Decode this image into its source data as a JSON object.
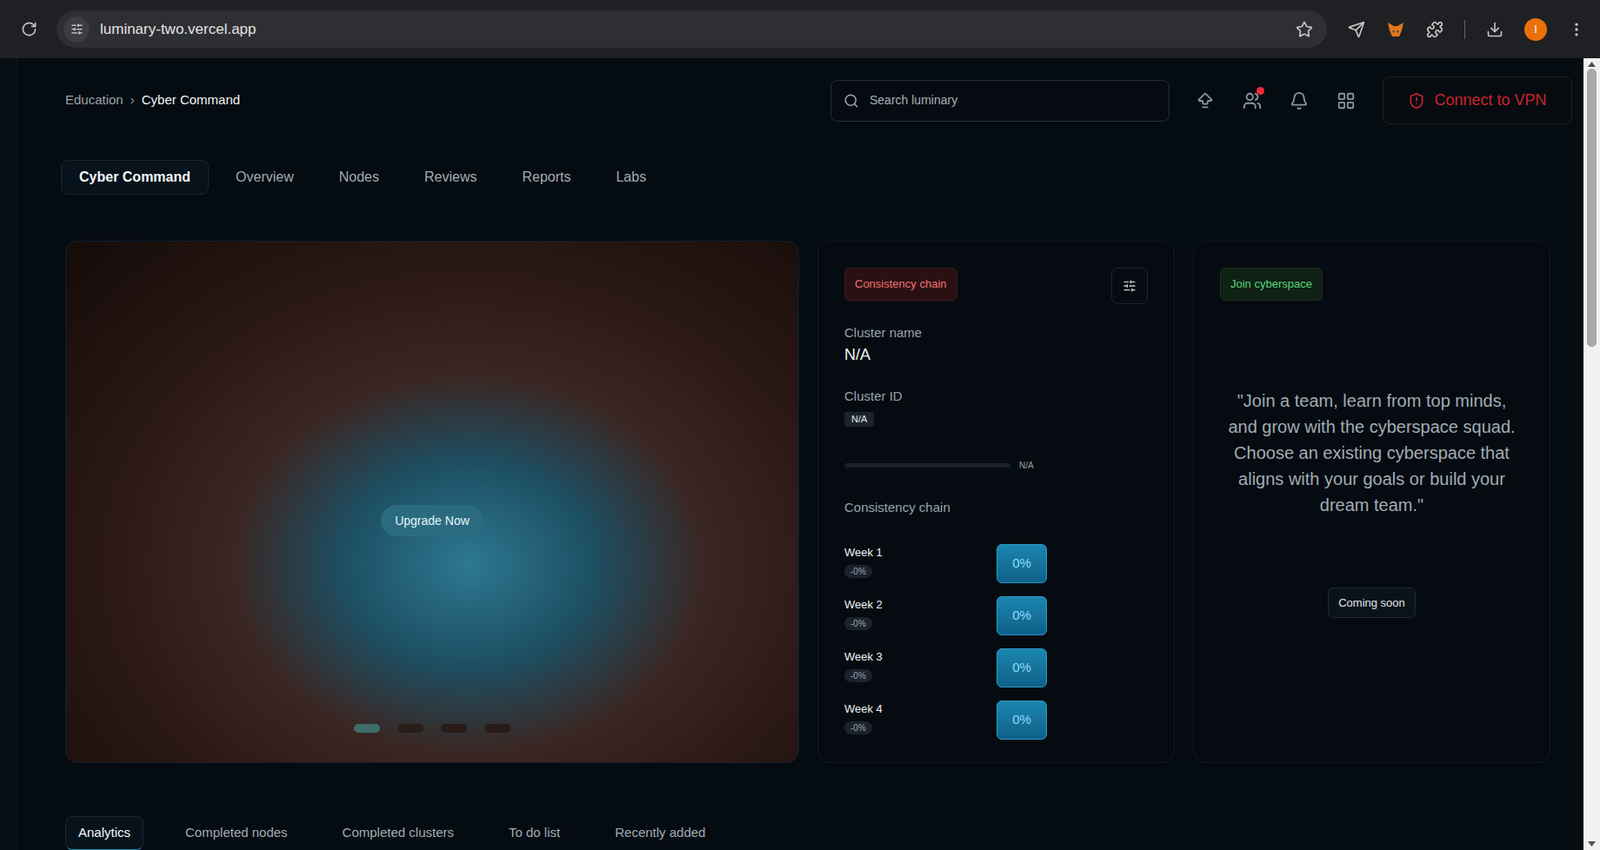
{
  "browser": {
    "url": "luminary-two.vercel.app",
    "profile_initial": "I"
  },
  "breadcrumb": {
    "items": [
      "Education",
      "Cyber Command"
    ],
    "separator": "›"
  },
  "search": {
    "placeholder": "Search luminary"
  },
  "header_actions": [
    {
      "badge": false
    },
    {
      "badge": true
    },
    {
      "badge": false
    },
    {
      "badge": false
    }
  ],
  "vpn_button": {
    "label": "Connect to VPN"
  },
  "tabs": [
    {
      "label": "Cyber Command",
      "selected": true
    },
    {
      "label": "Overview",
      "selected": false
    },
    {
      "label": "Nodes",
      "selected": false
    },
    {
      "label": "Reviews",
      "selected": false
    },
    {
      "label": "Reports",
      "selected": false
    },
    {
      "label": "Labs",
      "selected": false
    }
  ],
  "hero": {
    "button": "Upgrade Now",
    "slides": [
      {
        "selected": true
      },
      {
        "selected": false
      },
      {
        "selected": false
      },
      {
        "selected": false
      }
    ]
  },
  "consistency_card": {
    "badge": "Consistency chain",
    "cluster_name_label": "Cluster name",
    "cluster_name": "N/A",
    "cluster_id_label": "Cluster ID",
    "cluster_id": "N/A",
    "progress": {
      "level": 0,
      "reading": "N/A"
    },
    "chain_title": "Consistency chain",
    "weeks": [
      {
        "label": "Week 1",
        "change": "-0%",
        "value": "0%"
      },
      {
        "label": "Week 2",
        "change": "-0%",
        "value": "0%"
      },
      {
        "label": "Week 3",
        "change": "-0%",
        "value": "0%"
      },
      {
        "label": "Week 4",
        "change": "-0%",
        "value": "0%"
      }
    ]
  },
  "join_card": {
    "badge": "Join cyberspace",
    "quote": "\"Join a team, learn from top minds, and grow with the cyberspace squad. Choose an existing cyberspace that aligns with your goals or build your dream team.\"",
    "button": "Coming soon"
  },
  "bottom_tabs": [
    {
      "label": "Analytics",
      "selected": true
    },
    {
      "label": "Completed nodes",
      "selected": false
    },
    {
      "label": "Completed clusters",
      "selected": false
    },
    {
      "label": "To do list",
      "selected": false
    },
    {
      "label": "Recently added",
      "selected": false
    }
  ]
}
